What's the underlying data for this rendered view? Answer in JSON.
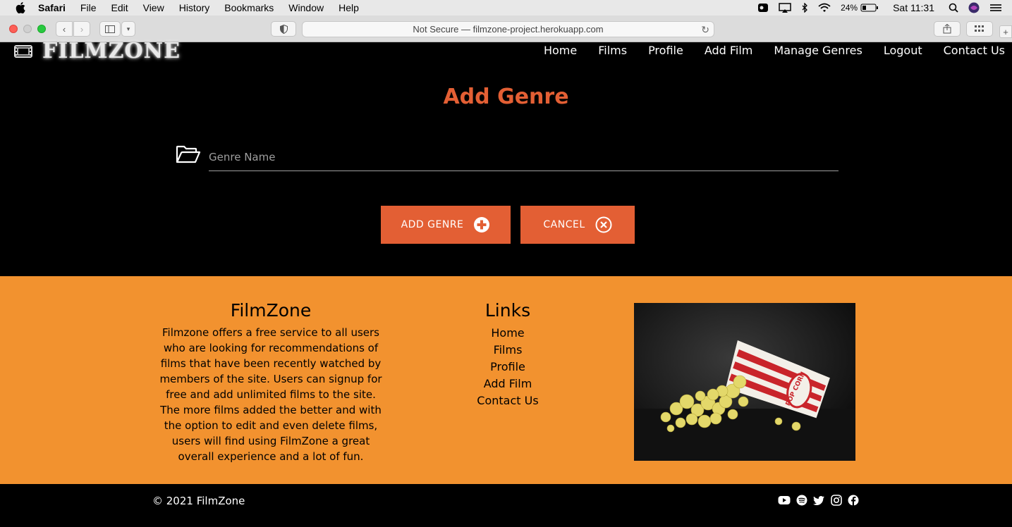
{
  "menubar": {
    "app": "Safari",
    "items": [
      "File",
      "Edit",
      "View",
      "History",
      "Bookmarks",
      "Window",
      "Help"
    ],
    "battery": "24%",
    "clock": "Sat 11:31"
  },
  "browser": {
    "url_text": "Not Secure — filmzone-project.herokuapp.com"
  },
  "site": {
    "logo": "FILMZONE",
    "nav": [
      "Home",
      "Films",
      "Profile",
      "Add Film",
      "Manage Genres",
      "Logout",
      "Contact Us"
    ]
  },
  "form": {
    "title": "Add Genre",
    "genre_placeholder": "Genre Name",
    "add_label": "ADD GENRE",
    "cancel_label": "CANCEL"
  },
  "footer": {
    "about_title": "FilmZone",
    "about_text": "Filmzone offers a free service to all users who are looking for recommendations of films that have been recently watched by members of the site. Users can signup for free and add unlimited films to the site. The more films added the better and with the option to edit and even delete films, users will find using FilmZone a great overall experience and a lot of fun.",
    "links_title": "Links",
    "links": [
      "Home",
      "Films",
      "Profile",
      "Add Film",
      "Contact Us"
    ],
    "popcorn_label": "POP CORN"
  },
  "bottom": {
    "copyright": "© 2021 FilmZone",
    "social": [
      "youtube-icon",
      "spotify-icon",
      "twitter-icon",
      "instagram-icon",
      "facebook-icon"
    ]
  },
  "colors": {
    "accent": "#e35f34",
    "footer_bg": "#f2922f"
  }
}
